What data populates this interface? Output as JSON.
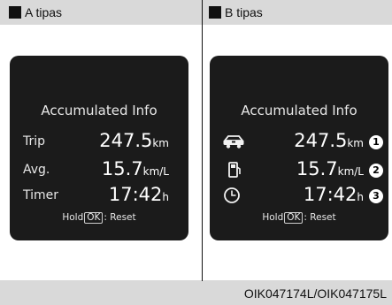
{
  "panel_a": {
    "heading": "A tipas",
    "title": "Accumulated Info",
    "rows": [
      {
        "label": "Trip",
        "value": "247.5",
        "unit": "km"
      },
      {
        "label": "Avg.",
        "value": "15.7",
        "unit": "km/L"
      },
      {
        "label": "Timer",
        "value": "17:42",
        "unit": "h"
      }
    ],
    "hint_prefix": "Hold",
    "hint_key": "OK",
    "hint_suffix": ": Reset"
  },
  "panel_b": {
    "heading": "B tipas",
    "title": "Accumulated Info",
    "rows": [
      {
        "icon": "car-trip-icon",
        "value": "247.5",
        "unit": "km",
        "marker": "1"
      },
      {
        "icon": "fuel-pump-icon",
        "value": "15.7",
        "unit": "km/L",
        "marker": "2"
      },
      {
        "icon": "clock-icon",
        "value": "17:42",
        "unit": "h",
        "marker": "3"
      }
    ],
    "hint_prefix": "Hold",
    "hint_key": "OK",
    "hint_suffix": ": Reset"
  },
  "image_code": "OIK047174L/OIK047175L",
  "colors": {
    "header_band": "#d9d9d9",
    "screen_bg": "#1b1b1b",
    "screen_text": "#f1f1f1"
  }
}
